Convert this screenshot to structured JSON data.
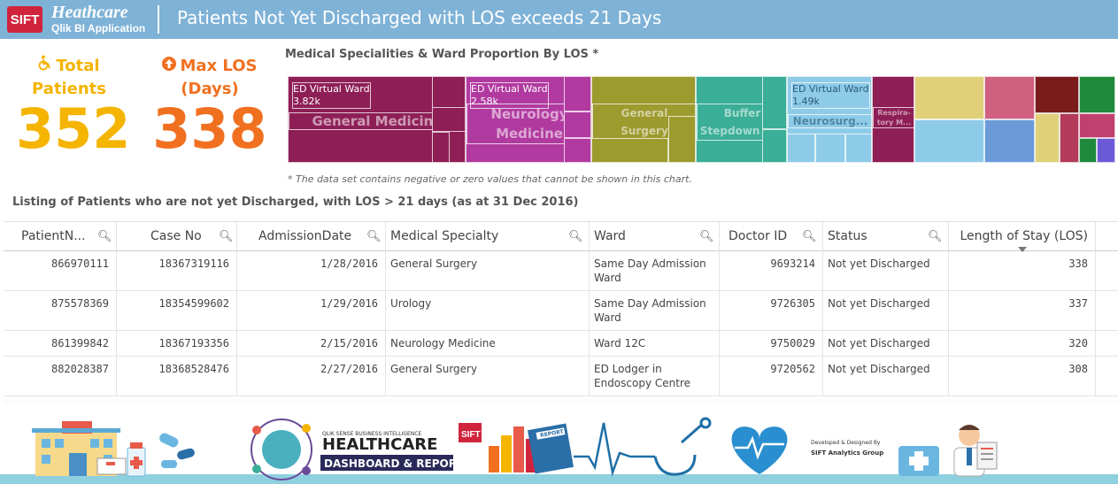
{
  "header": {
    "logo": "SIFT",
    "brand_line1": "Heathcare",
    "brand_line2": "Qlik BI Application",
    "title": "Patients Not Yet Discharged with LOS exceeds 21 Days"
  },
  "kpis": {
    "total": {
      "label1": "Total",
      "label2": "Patients",
      "value": "352",
      "icon": "wheelchair-icon",
      "color": "#f4b400"
    },
    "max_los": {
      "label1": "Max LOS",
      "label2": "(Days)",
      "value": "338",
      "icon": "arrow-up-circle-icon",
      "color": "#f07020"
    }
  },
  "treemap": {
    "title": "Medical Specialities & Ward Proportion By LOS *",
    "note": "* The data set contains negative or zero values that cannot be shown in this chart.",
    "groups": [
      {
        "name": "General Medicine",
        "ward": "ED Virtual Ward",
        "value": "3.82k",
        "color": "#8e1f56"
      },
      {
        "name": "Neurology Medicine",
        "ward": "ED Virtual Ward",
        "value": "2.58k",
        "color": "#b13aa0"
      },
      {
        "name": "General Surgery",
        "color": "#9d9a2e"
      },
      {
        "name": "Buffer Stepdown U...",
        "color": "#3aae96"
      },
      {
        "name": "Neurosurg...",
        "ward": "ED Virtual Ward",
        "value": "1.49k",
        "color": "#8ecbe8"
      },
      {
        "name": "Respira-tory M...",
        "color": "#8e1f56"
      }
    ]
  },
  "listing": {
    "title": "Listing of Patients who are not yet Discharged, with LOS > 21 days (as at 31 Dec 2016)",
    "columns": [
      "PatientN...",
      "Case No",
      "AdmissionDate",
      "Medical Specialty",
      "Ward",
      "Doctor ID",
      "Status",
      "Length of Stay (LOS)"
    ],
    "rows": [
      {
        "patient": "866970111",
        "case": "18367319116",
        "date": "1/28/2016",
        "specialty": "General Surgery",
        "ward1": "Same Day Admission",
        "ward2": "Ward",
        "doctor": "9693214",
        "status": "Not yet Discharged",
        "los": "338"
      },
      {
        "patient": "875578369",
        "case": "18354599602",
        "date": "1/29/2016",
        "specialty": "Urology",
        "ward1": "Same Day Admission",
        "ward2": "Ward",
        "doctor": "9726305",
        "status": "Not yet Discharged",
        "los": "337"
      },
      {
        "patient": "861399842",
        "case": "18367193356",
        "date": "2/15/2016",
        "specialty": "Neurology Medicine",
        "ward1": "Ward 12C",
        "ward2": "",
        "doctor": "9750029",
        "status": "Not yet Discharged",
        "los": "320"
      },
      {
        "patient": "882028387",
        "case": "18368528476",
        "date": "2/27/2016",
        "specialty": "General Surgery",
        "ward1": "ED Lodger in",
        "ward2": "Endoscopy Centre",
        "doctor": "9720562",
        "status": "Not yet Discharged",
        "los": "308"
      }
    ]
  },
  "banner": {
    "small": "QLIK SENSE BUSINESS INTELLIGENCE",
    "title": "HEALTHCARE",
    "subtitle": "DASHBOARD & REPORTS",
    "logo": "SIFT",
    "report_label": "REPORT",
    "credit1": "Developed & Designed By",
    "credit2": "SIFT Analytics Group"
  }
}
